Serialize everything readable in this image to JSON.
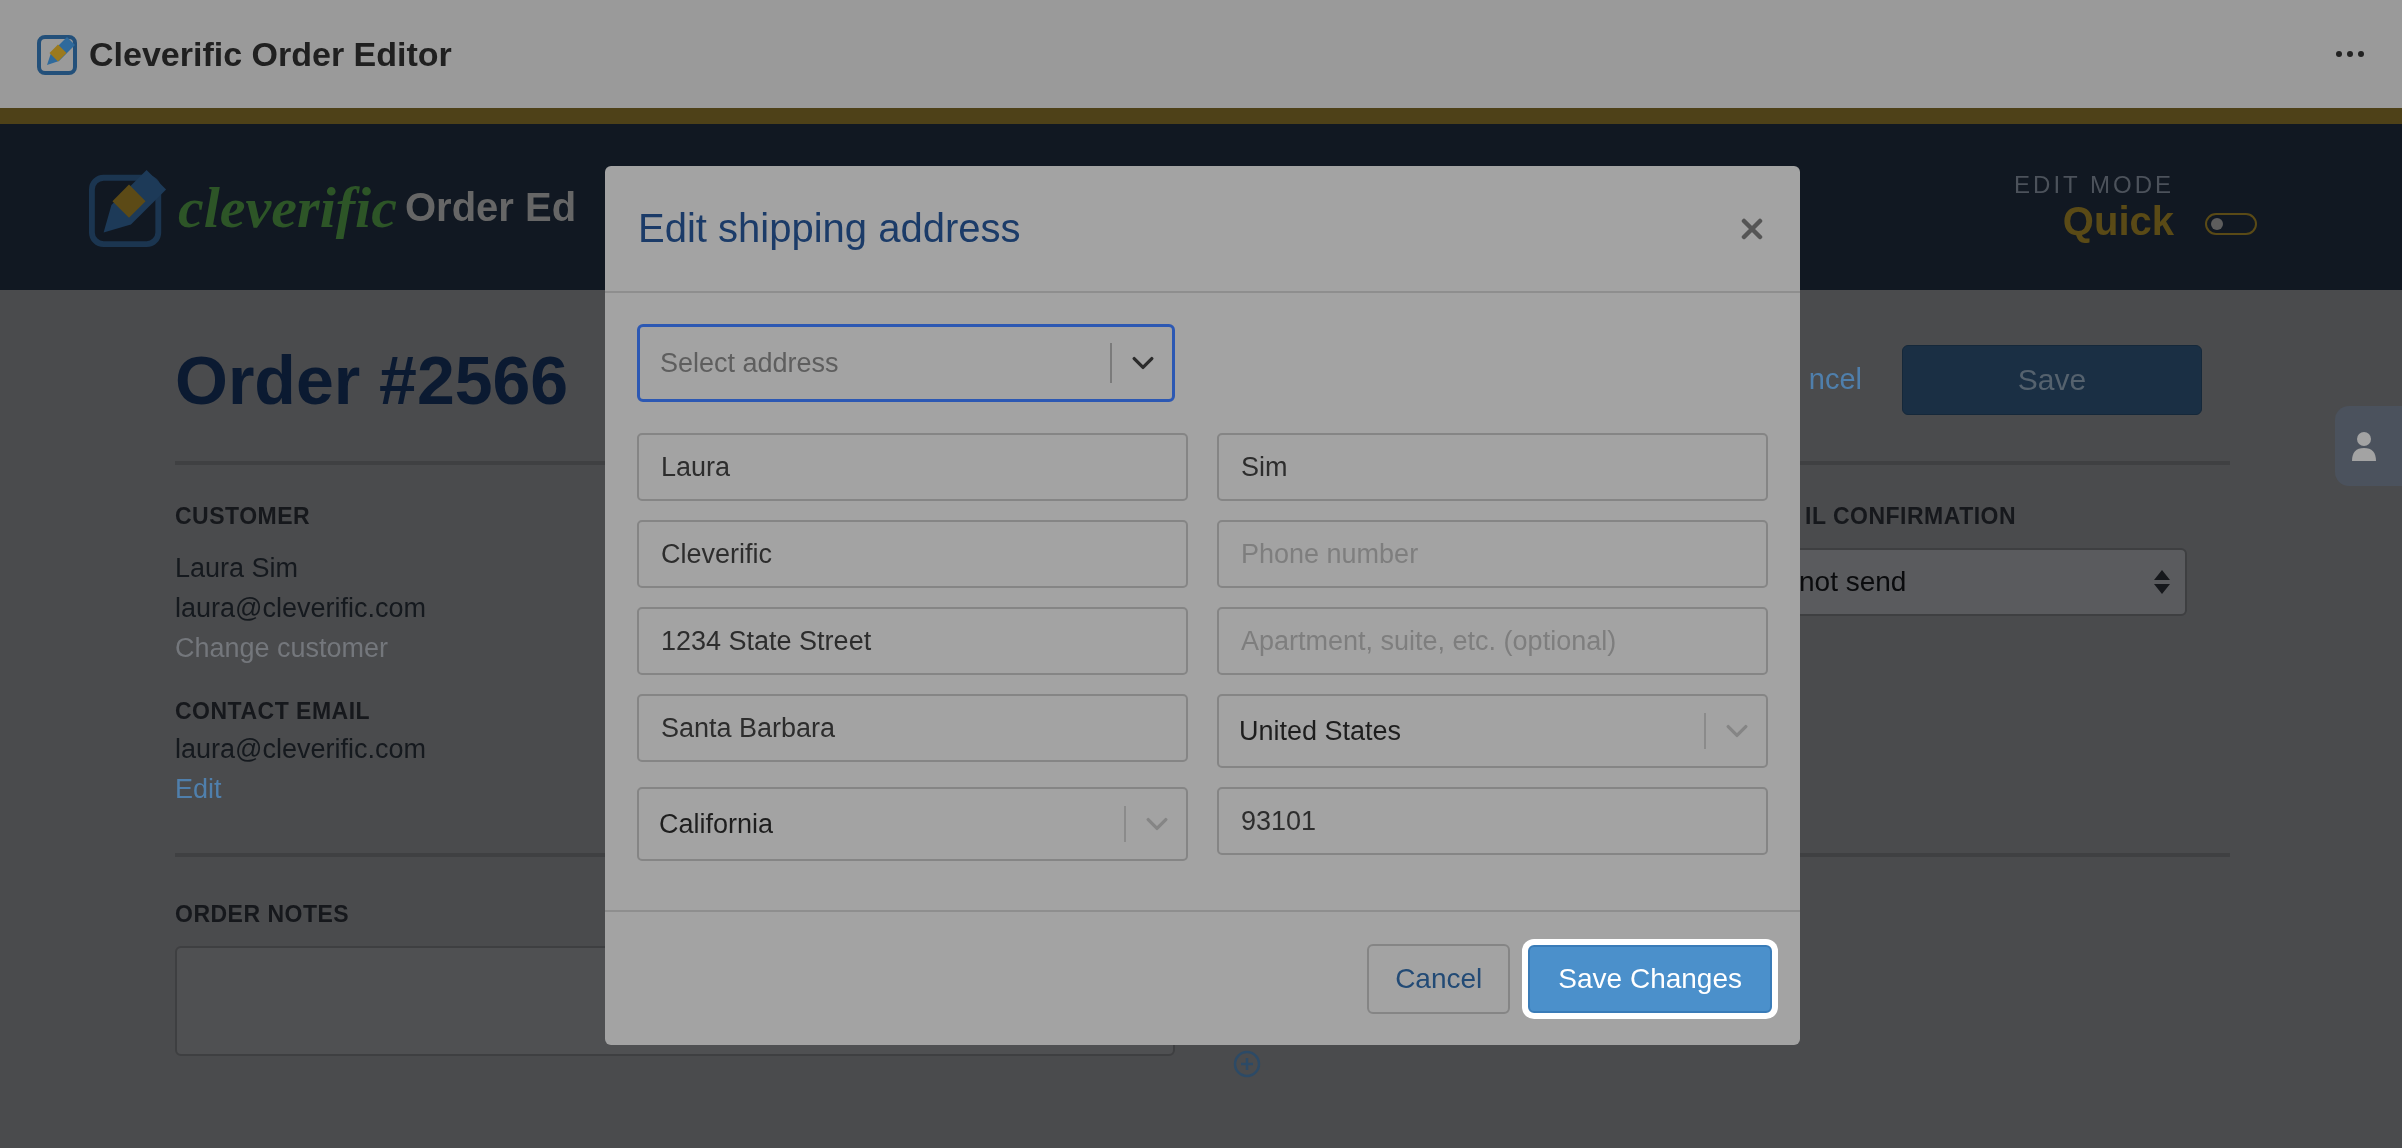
{
  "app_bar": {
    "title": "Cleverific Order Editor"
  },
  "header": {
    "brand": "cleverific",
    "product": "Order Ed",
    "edit_mode_label": "EDIT MODE",
    "edit_mode_value": "Quick",
    "toggle_on": false
  },
  "order": {
    "title": "Order #2566",
    "cancel_link": "ncel",
    "save_button": "Save",
    "customer": {
      "heading": "CUSTOMER",
      "name": "Laura Sim",
      "email": "laura@cleverific.com",
      "change_link": "Change customer"
    },
    "contact_email": {
      "heading": "CONTACT EMAIL",
      "email": "laura@cleverific.com",
      "edit_link": "Edit"
    },
    "confirmation": {
      "heading": "IL CONFIRMATION",
      "value": "not send"
    },
    "order_notes": {
      "heading": "ORDER NOTES"
    }
  },
  "modal": {
    "title": "Edit shipping address",
    "address_select": {
      "placeholder": "Select address"
    },
    "fields": [
      {
        "kind": "text",
        "value": "Laura"
      },
      {
        "kind": "text",
        "value": "Sim"
      },
      {
        "kind": "text",
        "value": "Cleverific"
      },
      {
        "kind": "text",
        "placeholder": "Phone number"
      },
      {
        "kind": "text",
        "value": "1234 State Street"
      },
      {
        "kind": "text",
        "placeholder": "Apartment, suite, etc. (optional)"
      },
      {
        "kind": "text",
        "value": "Santa Barbara"
      },
      {
        "kind": "select",
        "value": "United States"
      },
      {
        "kind": "select",
        "value": "California"
      },
      {
        "kind": "text",
        "value": "93101"
      }
    ],
    "buttons": [
      {
        "label": "Cancel",
        "kind": "secondary"
      },
      {
        "label": "Save Changes",
        "kind": "primary"
      }
    ]
  }
}
